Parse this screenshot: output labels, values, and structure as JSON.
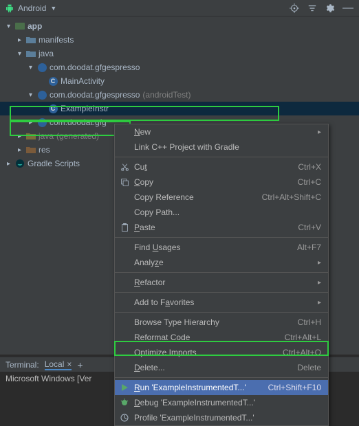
{
  "topbar": {
    "title": "Android",
    "arrow": "▼"
  },
  "tree": {
    "app": "app",
    "manifests": "manifests",
    "java": "java",
    "pkg1": "com.doodat.gfgespresso",
    "mainActivity": "MainActivity",
    "pkg2": "com.doodat.gfgespresso",
    "pkg2_suffix": "(androidTest)",
    "exampleInstr": "ExampleInstr",
    "pkg3": "com.doodat.gfg",
    "java_generated": "java",
    "java_generated_suffix": "(generated)",
    "res": "res",
    "gradleScripts": "Gradle Scripts"
  },
  "menu": {
    "new": "New",
    "link": "Link C++ Project with Gradle",
    "cut": "Cut",
    "cut_k": "Ctrl+X",
    "copy": "Copy",
    "copy_k": "Ctrl+C",
    "copyRef": "Copy Reference",
    "copyRef_k": "Ctrl+Alt+Shift+C",
    "copyPath": "Copy Path...",
    "paste": "Paste",
    "paste_k": "Ctrl+V",
    "findUsages": "Find Usages",
    "findUsages_k": "Alt+F7",
    "analyze": "Analyze",
    "refactor": "Refactor",
    "addFav": "Add to Favorites",
    "browseTH": "Browse Type Hierarchy",
    "browseTH_k": "Ctrl+H",
    "reformat": "Reformat Code",
    "reformat_k": "Ctrl+Alt+L",
    "optImports": "Optimize Imports",
    "optImports_k": "Ctrl+Alt+O",
    "delete": "Delete...",
    "delete_k": "Delete",
    "run": "Run 'ExampleInstrumentedT...'",
    "run_k": "Ctrl+Shift+F10",
    "debug": "Debug 'ExampleInstrumentedT...'",
    "profile": "Profile 'ExampleInstrumentedT...'"
  },
  "terminal": {
    "label": "Terminal:",
    "tab": "Local",
    "close": "×",
    "content": "Microsoft Windows [Ver"
  }
}
